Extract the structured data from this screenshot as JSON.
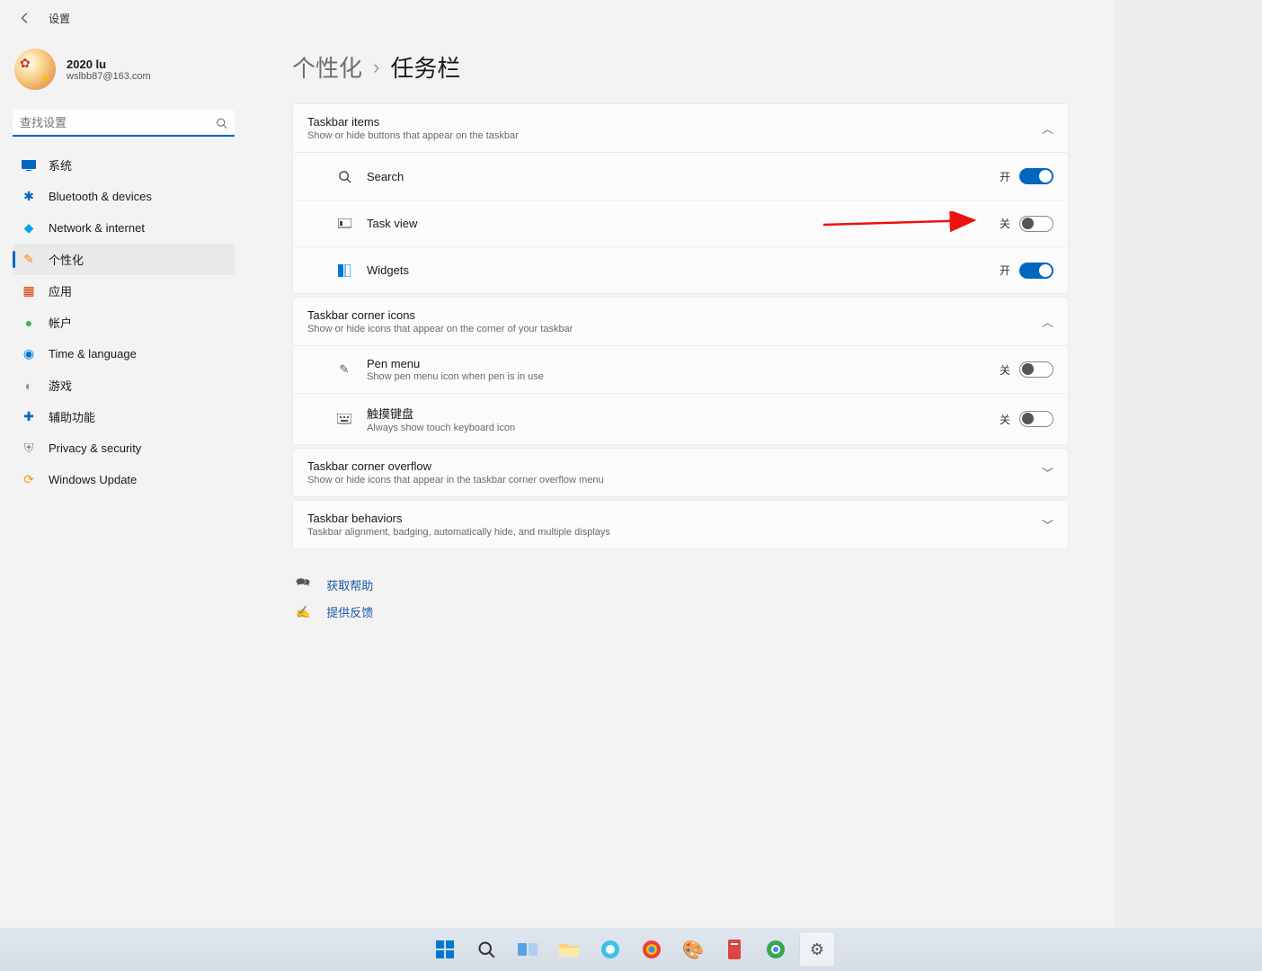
{
  "topbar": {
    "title": "设置"
  },
  "user": {
    "name": "2020 lu",
    "email": "wslbb87@163.com"
  },
  "search": {
    "placeholder": "查找设置"
  },
  "nav": [
    {
      "id": "system",
      "label": "系统",
      "color": "#0067c0"
    },
    {
      "id": "bluetooth",
      "label": "Bluetooth & devices",
      "color": "#0067c0"
    },
    {
      "id": "network",
      "label": "Network & internet",
      "color": "#00a4ef"
    },
    {
      "id": "personalization",
      "label": "个性化",
      "color": "#ff8c00",
      "active": true
    },
    {
      "id": "apps",
      "label": "应用",
      "color": "#d83b01"
    },
    {
      "id": "accounts",
      "label": "帐户",
      "color": "#47b04b"
    },
    {
      "id": "time",
      "label": "Time & language",
      "color": "#0078d4"
    },
    {
      "id": "gaming",
      "label": "游戏",
      "color": "#8a8a8a"
    },
    {
      "id": "accessibility",
      "label": "辅助功能",
      "color": "#0067c0"
    },
    {
      "id": "privacy",
      "label": "Privacy & security",
      "color": "#888888"
    },
    {
      "id": "windowsupdate",
      "label": "Windows Update",
      "color": "#f2a100"
    }
  ],
  "breadcrumb": {
    "parent": "个性化",
    "sep": "›",
    "current": "任务栏"
  },
  "sections": {
    "taskbarItems": {
      "title": "Taskbar items",
      "sub": "Show or hide buttons that appear on the taskbar",
      "expanded": true,
      "rows": [
        {
          "id": "search",
          "title": "Search",
          "state": "开",
          "on": true
        },
        {
          "id": "taskview",
          "title": "Task view",
          "state": "关",
          "on": false,
          "annotated": true
        },
        {
          "id": "widgets",
          "title": "Widgets",
          "state": "开",
          "on": true
        }
      ]
    },
    "cornerIcons": {
      "title": "Taskbar corner icons",
      "sub": "Show or hide icons that appear on the corner of your taskbar",
      "expanded": true,
      "rows": [
        {
          "id": "pen",
          "title": "Pen menu",
          "sub": "Show pen menu icon when pen is in use",
          "state": "关",
          "on": false
        },
        {
          "id": "touchkb",
          "title": "触摸键盘",
          "sub": "Always show touch keyboard icon",
          "state": "关",
          "on": false
        }
      ]
    },
    "overflow": {
      "title": "Taskbar corner overflow",
      "sub": "Show or hide icons that appear in the taskbar corner overflow menu",
      "expanded": false
    },
    "behaviors": {
      "title": "Taskbar behaviors",
      "sub": "Taskbar alignment, badging, automatically hide, and multiple displays",
      "expanded": false
    }
  },
  "help": {
    "getHelp": "获取帮助",
    "feedback": "提供反馈"
  },
  "taskbarApps": [
    "start",
    "search",
    "taskview",
    "explorer",
    "edge",
    "chrome",
    "paint",
    "app8",
    "chrome2",
    "settings"
  ]
}
